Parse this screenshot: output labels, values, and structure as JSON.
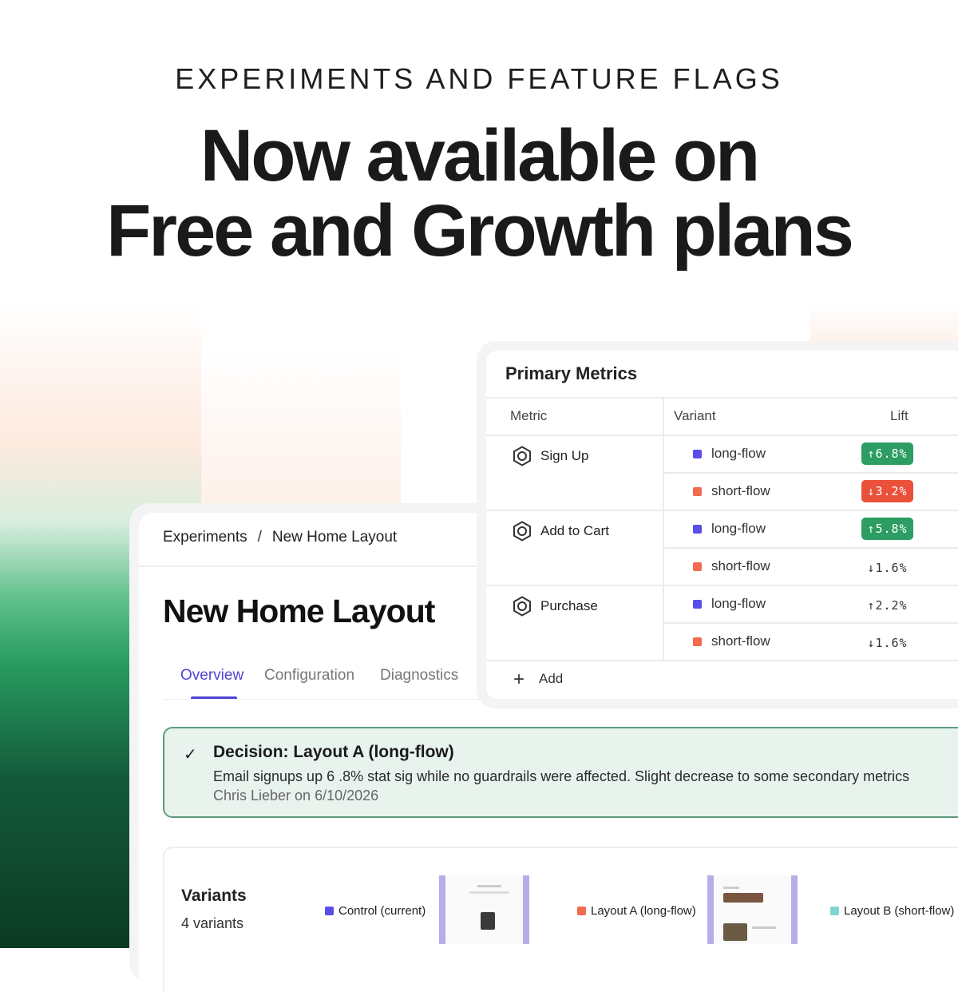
{
  "hero": {
    "eyebrow": "EXPERIMENTS AND FEATURE FLAGS",
    "headline_line1": "Now available on",
    "headline_line2": "Free and Growth plans"
  },
  "colors": {
    "accent": "#4f44d6",
    "long_flow": "#5b4ee8",
    "short_flow": "#f26b4f",
    "layout_b": "#7fd6d0",
    "lift_up": "#2d9d63",
    "lift_down": "#e9513a",
    "decision_bg": "#e9f3ee"
  },
  "experiment": {
    "breadcrumb": [
      "Experiments",
      "New Home Layout"
    ],
    "breadcrumb_separator": "/",
    "title": "New Home Layout",
    "tabs": [
      {
        "label": "Overview",
        "active": true
      },
      {
        "label": "Configuration",
        "active": false
      },
      {
        "label": "Diagnostics",
        "active": false
      }
    ],
    "decision": {
      "icon": "check-icon",
      "title": "Decision: Layout A (long-flow)",
      "body": "Email signups up 6 .8% stat sig while no guardrails were affected. Slight decrease to some secondary metrics",
      "byline": "Chris Lieber on 6/10/2026"
    },
    "variants": {
      "title": "Variants",
      "count": "4 variants",
      "items": [
        {
          "label": "Control (current)"
        },
        {
          "label": "Layout A (long-flow)"
        },
        {
          "label": "Layout B (short-flow)"
        }
      ]
    }
  },
  "metrics": {
    "title": "Primary Metrics",
    "headers": {
      "metric": "Metric",
      "variant": "Variant",
      "lift": "Lift"
    },
    "rows": [
      {
        "metric": "Sign Up",
        "variants": [
          {
            "name": "long-flow",
            "lift": "↑6.8%",
            "kind": "up"
          },
          {
            "name": "short-flow",
            "lift": "↓3.2%",
            "kind": "down"
          }
        ]
      },
      {
        "metric": "Add to Cart",
        "variants": [
          {
            "name": "long-flow",
            "lift": "↑5.8%",
            "kind": "up"
          },
          {
            "name": "short-flow",
            "lift": "↓1.6%",
            "kind": "plain"
          }
        ]
      },
      {
        "metric": "Purchase",
        "variants": [
          {
            "name": "long-flow",
            "lift": "↑2.2%",
            "kind": "plain"
          },
          {
            "name": "short-flow",
            "lift": "↓1.6%",
            "kind": "plain"
          }
        ]
      }
    ],
    "add_label": "Add"
  }
}
